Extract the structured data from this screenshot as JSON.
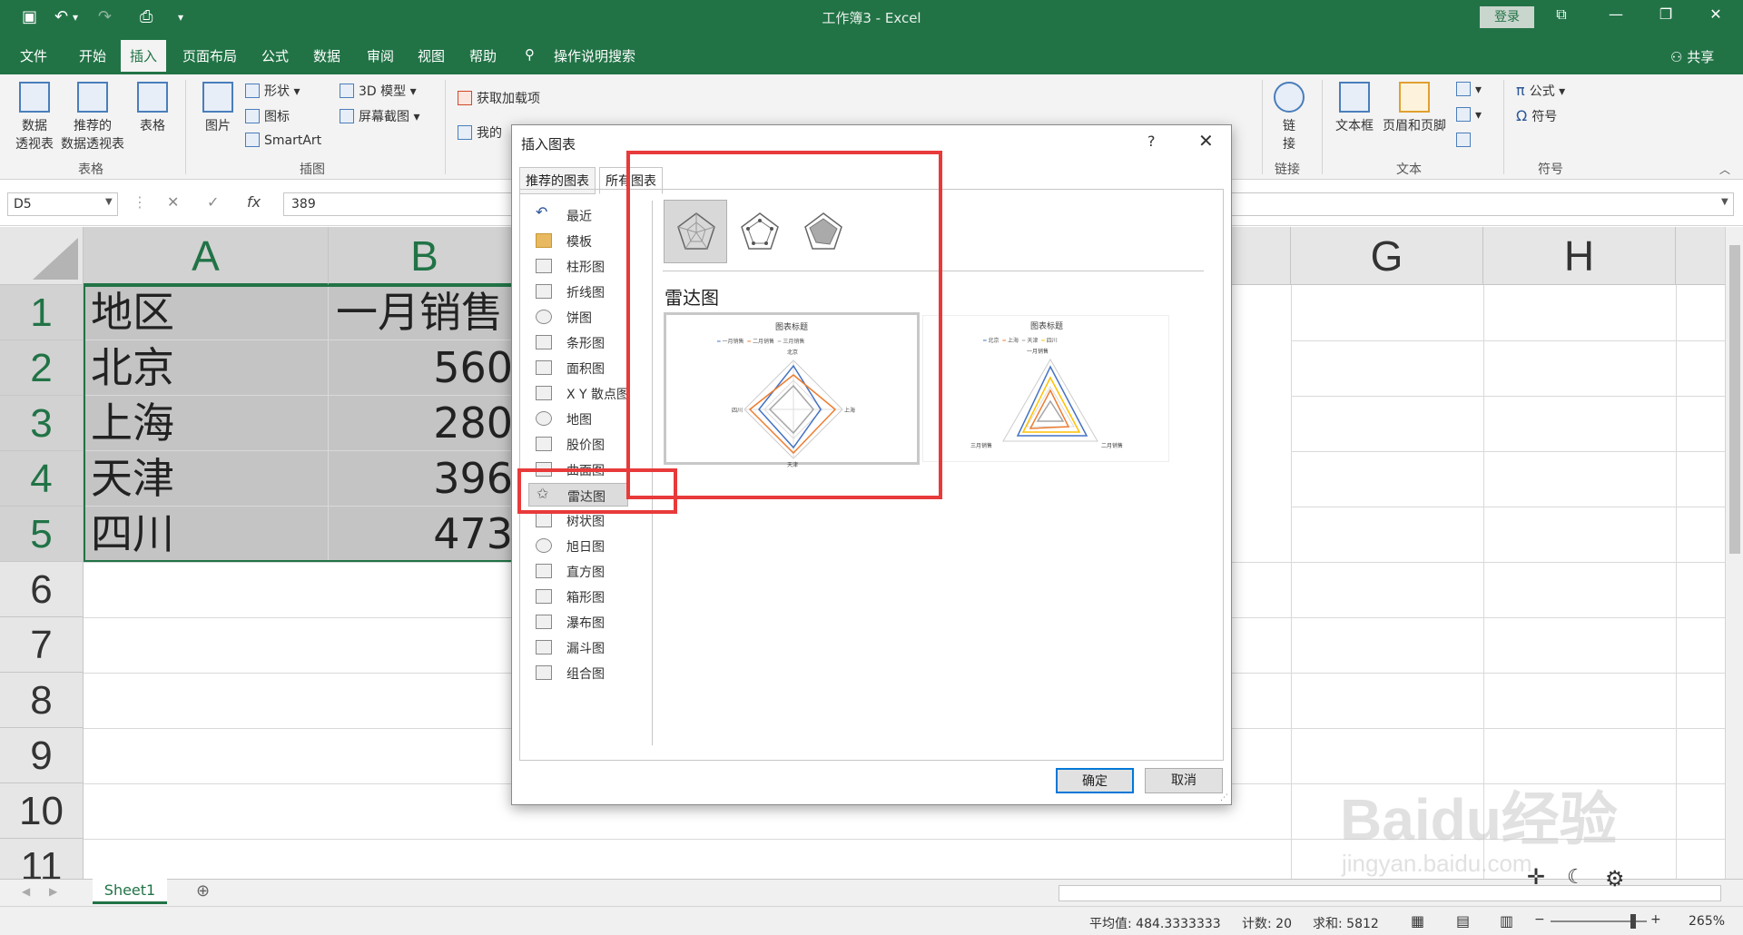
{
  "titlebar": {
    "title": "工作簿3  -  Excel",
    "login": "登录"
  },
  "tabs": [
    {
      "label": "文件"
    },
    {
      "label": "开始"
    },
    {
      "label": "插入"
    },
    {
      "label": "页面布局"
    },
    {
      "label": "公式"
    },
    {
      "label": "数据"
    },
    {
      "label": "审阅"
    },
    {
      "label": "视图"
    },
    {
      "label": "帮助"
    },
    {
      "label": "操作说明搜索"
    }
  ],
  "share": "共享",
  "ribbon": {
    "pivot": "数据\n透视表",
    "recommended_pivot": "推荐的\n数据透视表",
    "table": "表格",
    "group_tables": "表格",
    "pictures": "图片",
    "shapes": "形状",
    "icons": "图标",
    "smartart": "SmartArt",
    "model3d": "3D 模型",
    "screenshot": "屏幕截图",
    "group_illustrations": "插图",
    "get_addins": "获取加载项",
    "my_addins": "我的",
    "link": "链\n接",
    "group_links": "链接",
    "textbox": "文本框",
    "header_footer": "页眉和页脚",
    "group_text": "文本",
    "equation": "公式",
    "symbol": "符号",
    "group_symbols": "符号"
  },
  "formula_bar": {
    "name_box": "D5",
    "value": "389"
  },
  "columns": [
    "A",
    "B",
    "G",
    "H"
  ],
  "rows": [
    "1",
    "2",
    "3",
    "4",
    "5",
    "6",
    "7",
    "8",
    "9",
    "10",
    "11"
  ],
  "cells": [
    {
      "a": "地区",
      "b": "一月销售"
    },
    {
      "a": "北京",
      "b": "560"
    },
    {
      "a": "上海",
      "b": "280"
    },
    {
      "a": "天津",
      "b": "396"
    },
    {
      "a": "四川",
      "b": "473"
    }
  ],
  "sheet_tab": "Sheet1",
  "status": {
    "average": "平均值: 484.3333333",
    "count": "计数: 20",
    "sum": "求和: 5812",
    "zoom": "265%"
  },
  "dialog": {
    "title": "插入图表",
    "tab_recommended": "推荐的图表",
    "tab_all": "所有图表",
    "chart_types": [
      "最近",
      "模板",
      "柱形图",
      "折线图",
      "饼图",
      "条形图",
      "面积图",
      "X Y 散点图",
      "地图",
      "股价图",
      "曲面图",
      "雷达图",
      "树状图",
      "旭日图",
      "直方图",
      "箱形图",
      "瀑布图",
      "漏斗图",
      "组合图"
    ],
    "selected_type": "雷达图",
    "section_title": "雷达图",
    "preview1_title": "图表标题",
    "preview1_legend": [
      "一月销售",
      "二月销售",
      "三月销售"
    ],
    "preview1_axes": [
      "北京",
      "上海",
      "天津",
      "四川"
    ],
    "preview2_title": "图表标题",
    "preview2_legend": [
      "北京",
      "上海",
      "天津",
      "四川"
    ],
    "preview2_axes": [
      "一月销售",
      "二月销售",
      "三月销售"
    ],
    "ok": "确定",
    "cancel": "取消"
  },
  "watermark": {
    "line1": "Baidu经验",
    "line2": "jingyan.baidu.com"
  },
  "colors": {
    "excel_green": "#217346",
    "highlight": "#e83a3a"
  }
}
